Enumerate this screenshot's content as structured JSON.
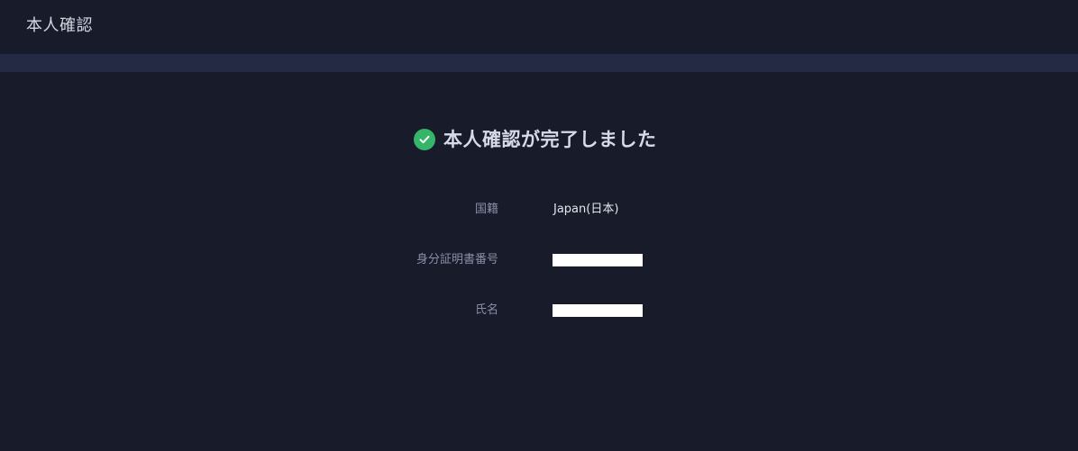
{
  "header": {
    "title": "本人確認"
  },
  "status": {
    "icon": "check-circle-icon",
    "icon_color": "#35b56a",
    "message": "本人確認が完了しました"
  },
  "details": [
    {
      "label": "国籍",
      "value": "Japan(日本)"
    },
    {
      "label": "身分証明書番号",
      "value": ""
    },
    {
      "label": "氏名",
      "value": ""
    }
  ]
}
